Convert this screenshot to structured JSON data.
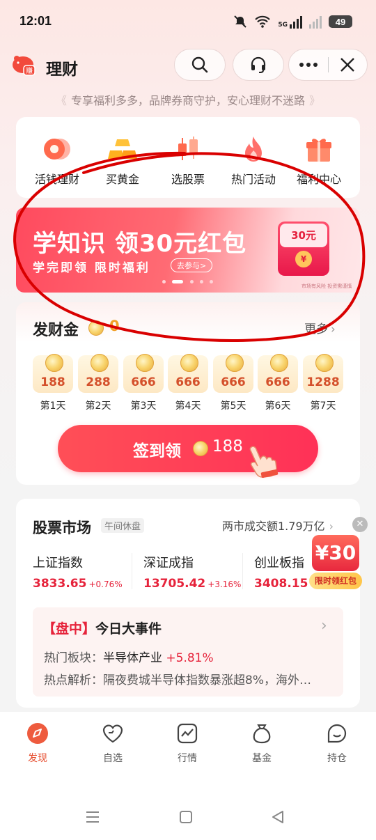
{
  "status_bar": {
    "time": "12:01",
    "network": "5G",
    "battery": "49"
  },
  "header": {
    "title": "理财",
    "slogan": "专享福利多多，品牌券商守护，安心理财不迷路",
    "logo_text": "赚"
  },
  "quick_nav": [
    {
      "label": "活钱理财",
      "icon": "coin-stack-icon"
    },
    {
      "label": "买黄金",
      "icon": "gold-bar-icon"
    },
    {
      "label": "选股票",
      "icon": "candlestick-icon"
    },
    {
      "label": "热门活动",
      "icon": "flame-icon"
    },
    {
      "label": "福利中心",
      "icon": "gift-box-icon"
    }
  ],
  "banner": {
    "title": "学知识 领30元红包",
    "subtitle": "学完即领  限时福利",
    "cta": "去参与>",
    "envelope_text": "30元",
    "note": "市场有风险 投资需谨慎"
  },
  "fa_cai_jin": {
    "title": "发财金",
    "count": "0",
    "more": "更多",
    "days": [
      {
        "amount": "188",
        "label": "第1天"
      },
      {
        "amount": "288",
        "label": "第2天"
      },
      {
        "amount": "666",
        "label": "第3天"
      },
      {
        "amount": "666",
        "label": "第4天"
      },
      {
        "amount": "666",
        "label": "第5天"
      },
      {
        "amount": "666",
        "label": "第6天"
      },
      {
        "amount": "1288",
        "label": "第7天"
      }
    ],
    "sign_label": "签到领",
    "sign_value": "188"
  },
  "stock_market": {
    "title": "股票市场",
    "tag": "午间休盘",
    "volume": "两市成交额1.79万亿",
    "indices": [
      {
        "name": "上证指数",
        "value": "3833.65",
        "change": "+0.76%"
      },
      {
        "name": "深证成指",
        "value": "13705.42",
        "change": "+3.16%"
      },
      {
        "name": "创业板指",
        "value": "3408.15",
        "change": "+"
      }
    ],
    "event": {
      "prefix": "【盘中】",
      "title": "今日大事件",
      "sector_label": "热门板块：",
      "sector_name": "半导体产业",
      "sector_change": "+5.81%",
      "analysis_label": "热点解析：",
      "analysis_text": "隔夜费城半导体指数暴涨超8%，海外…"
    }
  },
  "floating_promo": {
    "amount": "¥30",
    "label": "限时领红包"
  },
  "bottom_nav": [
    {
      "label": "发现",
      "icon": "compass-icon",
      "active": true
    },
    {
      "label": "自选",
      "icon": "heart-icon",
      "active": false
    },
    {
      "label": "行情",
      "icon": "chart-icon",
      "active": false
    },
    {
      "label": "基金",
      "icon": "money-bag-icon",
      "active": false
    },
    {
      "label": "持仓",
      "icon": "smile-icon",
      "active": false
    }
  ],
  "colors": {
    "accent": "#e6233b",
    "gold": "#f1a027",
    "annotation": "#d90000"
  }
}
